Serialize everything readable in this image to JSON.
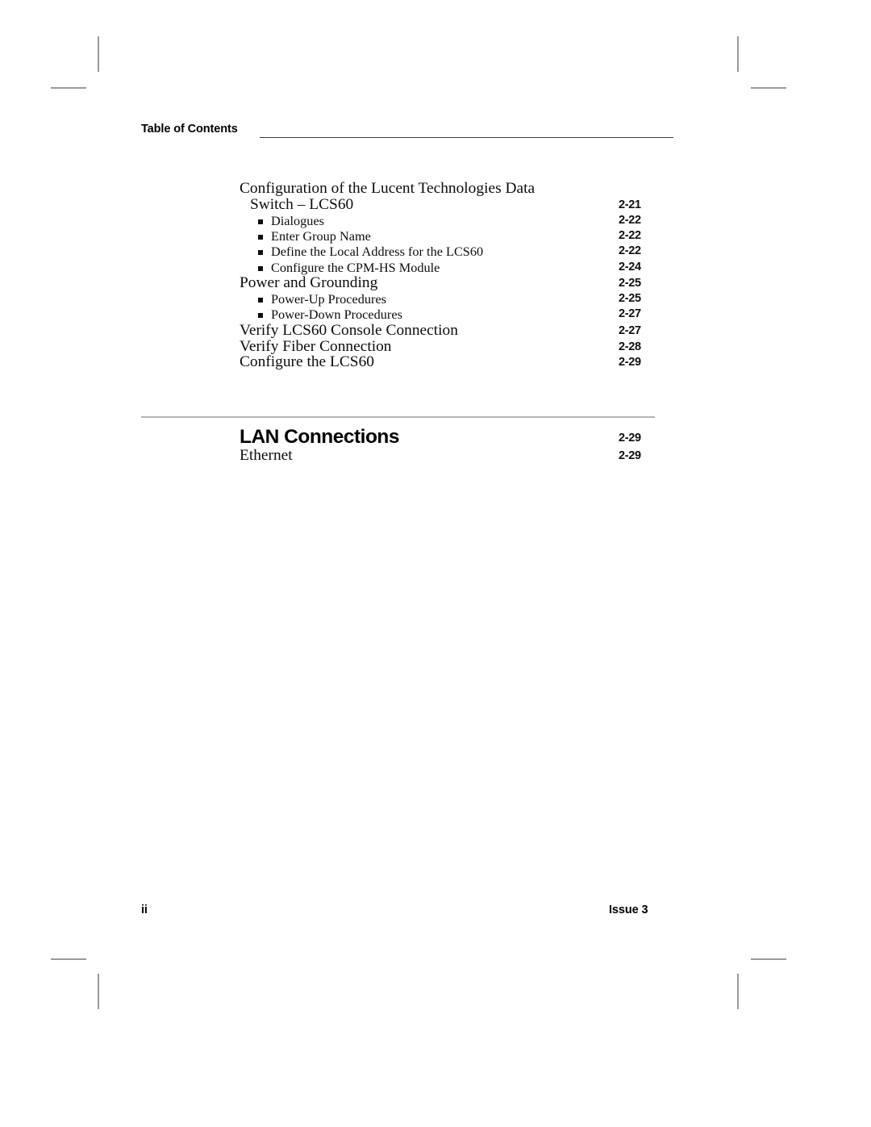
{
  "header": {
    "label": "Table of Contents"
  },
  "toc": {
    "entries": [
      {
        "level": 1,
        "text": "Configuration of the Lucent Technologies Data",
        "page": ""
      },
      {
        "level": "1cont",
        "text": "Switch –  LCS60",
        "page": "2-21"
      },
      {
        "level": 2,
        "text": "Dialogues",
        "page": "2-22"
      },
      {
        "level": 2,
        "text": "Enter Group Name",
        "page": "2-22"
      },
      {
        "level": 2,
        "text": "Define the Local Address for the LCS60",
        "page": "2-22"
      },
      {
        "level": 2,
        "text": "Configure the CPM-HS Module",
        "page": "2-24"
      },
      {
        "level": 1,
        "text": "Power and Grounding",
        "page": "2-25"
      },
      {
        "level": 2,
        "text": "Power-Up Procedures",
        "page": "2-25"
      },
      {
        "level": 2,
        "text": "Power-Down Procedures",
        "page": "2-27"
      },
      {
        "level": 1,
        "text": "Verify LCS60 Console Connection",
        "page": "2-27"
      },
      {
        "level": 1,
        "text": "Verify Fiber Connection",
        "page": "2-28"
      },
      {
        "level": 1,
        "text": "Configure the LCS60",
        "page": "2-29"
      }
    ]
  },
  "chapter": {
    "title": "LAN Connections",
    "page": "2-29",
    "sub_entries": [
      {
        "level": 1,
        "text": "Ethernet",
        "page": "2-29"
      }
    ]
  },
  "footer": {
    "page_number": "ii",
    "issue": "Issue 3"
  },
  "colors": {
    "text": "#000000",
    "header_rule": "#3a3a3a",
    "chapter_rule": "#b3b3b3",
    "crop_mark": "#9a9a9a",
    "page_background": "#ffffff"
  },
  "bullet_icon": "filled-square-bullet-icon"
}
